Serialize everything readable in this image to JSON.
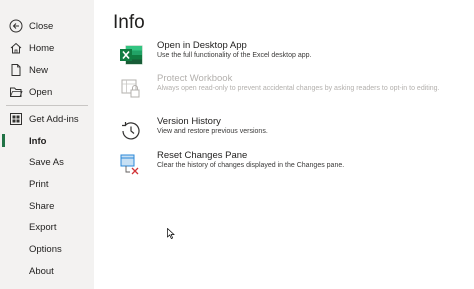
{
  "sidebar": {
    "items": [
      {
        "label": "Close",
        "icon": "back-arrow-icon"
      },
      {
        "label": "Home",
        "icon": "home-icon"
      },
      {
        "label": "New",
        "icon": "new-document-icon"
      },
      {
        "label": "Open",
        "icon": "folder-open-icon"
      },
      {
        "label": "Get Add-ins",
        "icon": "grid-addins-icon"
      },
      {
        "label": "Info"
      },
      {
        "label": "Save As"
      },
      {
        "label": "Print"
      },
      {
        "label": "Share"
      },
      {
        "label": "Export"
      },
      {
        "label": "Options"
      },
      {
        "label": "About"
      }
    ],
    "active_label": "Info",
    "accent": "#217346"
  },
  "main": {
    "title": "Info",
    "actions": [
      {
        "title": "Open in Desktop App",
        "description": "Use the full functionality of the Excel desktop app.",
        "icon": "excel-desktop-icon",
        "enabled": true
      },
      {
        "title": "Protect Workbook",
        "description": "Always open read-only to prevent accidental changes by asking readers to opt-in to editing.",
        "icon": "protect-workbook-icon",
        "enabled": false
      },
      {
        "title": "Version History",
        "description": "View and restore previous versions.",
        "icon": "version-history-icon",
        "enabled": true
      },
      {
        "title": "Reset Changes Pane",
        "description": "Clear the history of changes displayed in the Changes pane.",
        "icon": "reset-changes-icon",
        "enabled": true
      }
    ]
  }
}
